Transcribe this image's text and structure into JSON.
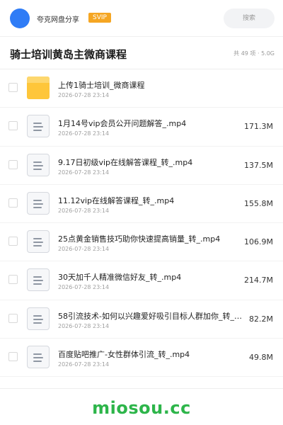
{
  "header": {
    "owner_name": "夸克网盘分享",
    "badge": "SVIP",
    "search_placeholder": "搜索"
  },
  "folder": {
    "title": "骑士培训黄岛主微商课程",
    "meta": "共 49 项 · 5.0G"
  },
  "files": [
    {
      "name": "上传1骑士培训_微商课程",
      "date": "2026-07-28 23:14",
      "size": "",
      "icon": "folder-icon"
    },
    {
      "name": "1月14号vip会员公开问题解答_.mp4",
      "date": "2026-07-28 23:14",
      "size": "171.3M",
      "icon": "document-icon"
    },
    {
      "name": "9.17日初级vip在线解答课程_转_.mp4",
      "date": "2026-07-28 23:14",
      "size": "137.5M",
      "icon": "document-icon"
    },
    {
      "name": "11.12vip在线解答课程_转_.mp4",
      "date": "2026-07-28 23:14",
      "size": "155.8M",
      "icon": "document-icon"
    },
    {
      "name": "25点黄金销售技巧助你快速提高销量_转_.mp4",
      "date": "2026-07-28 23:14",
      "size": "106.9M",
      "icon": "document-icon"
    },
    {
      "name": "30天加千人精准微信好友_转_.mp4",
      "date": "2026-07-28 23:14",
      "size": "214.7M",
      "icon": "document-icon"
    },
    {
      "name": "58引流技术-如何以兴趣爱好吸引目标人群加你_转_…",
      "date": "2026-07-28 23:14",
      "size": "82.2M",
      "icon": "document-icon"
    },
    {
      "name": "百度贴吧推广-女性群体引流_转_.mp4",
      "date": "2026-07-28 23:14",
      "size": "49.8M",
      "icon": "document-icon"
    }
  ],
  "watermark": "miosou.cc",
  "colors": {
    "accent_blue": "#2f7cf6",
    "svip_orange": "#f5a623",
    "folder_yellow": "#fec63a",
    "watermark_green": "#2db54a"
  }
}
